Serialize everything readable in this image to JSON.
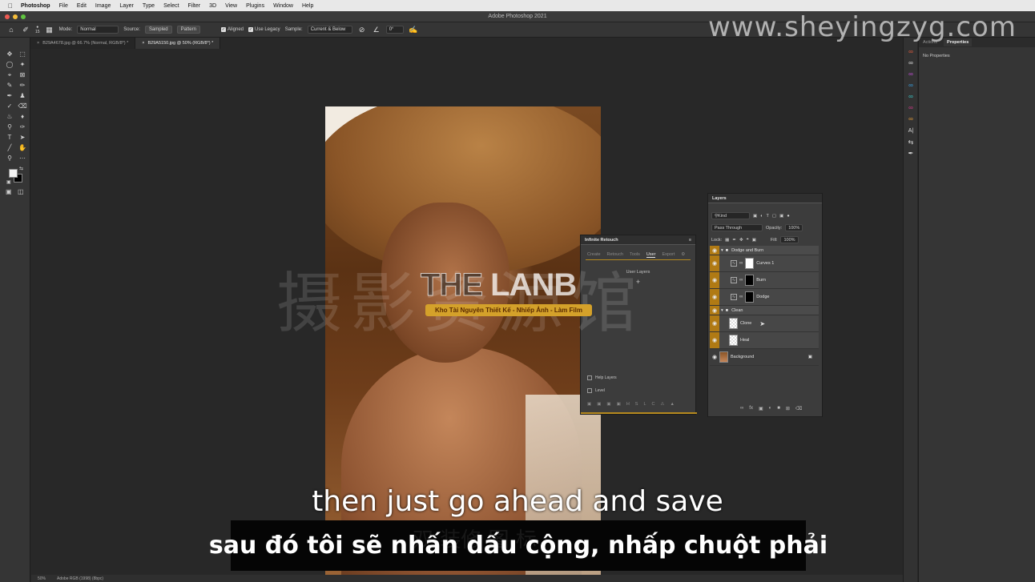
{
  "menubar": {
    "app": "Photoshop",
    "items": [
      "File",
      "Edit",
      "Image",
      "Layer",
      "Type",
      "Select",
      "Filter",
      "3D",
      "View",
      "Plugins",
      "Window",
      "Help"
    ]
  },
  "window": {
    "title": "Adobe Photoshop 2021"
  },
  "options": {
    "brush_size": "15",
    "mode_label": "Mode:",
    "mode_value": "Normal",
    "source_label": "Source:",
    "source_sampled": "Sampled",
    "source_pattern": "Pattern",
    "aligned": "Aligned",
    "use_legacy": "Use Legacy",
    "sample_label": "Sample:",
    "sample_value": "Current & Below",
    "angle": "0°"
  },
  "tabs": [
    {
      "label": "B29A4678.jpg @ 66.7% (Normal, RGB/8*) *"
    },
    {
      "label": "B29A5150.jpg @ 50% (RGB/8*) *"
    }
  ],
  "watermarks": {
    "site": "www.sheyingzyg.com",
    "chinese": "摄影资源馆",
    "lanb_left": "THE",
    "lanb_right": "LANB",
    "tagline": "Kho Tài Nguyên Thiết Kế - Nhiếp Ảnh - Làm Film",
    "ghost": "双 装修 图 标"
  },
  "subtitles": {
    "en": "then just go ahead and save",
    "vi": "sau đó tôi sẽ nhấn dấu cộng, nhấp chuột phải"
  },
  "retouch": {
    "title": "Infinite Retouch",
    "tabs": [
      "Create",
      "Retouch",
      "Tools",
      "User",
      "Export"
    ],
    "active_tab": "User",
    "user_layers": "User Layers",
    "plus": "+",
    "help_layers": "Help Layers",
    "level": "Level",
    "footer": [
      "H",
      "S",
      "L",
      "C"
    ]
  },
  "layers": {
    "title": "Layers",
    "kind": "Kind",
    "blend": "Pass Through",
    "opacity_label": "Opacity:",
    "opacity": "100%",
    "lock_label": "Lock:",
    "fill_label": "Fill:",
    "fill": "100%",
    "items": [
      {
        "name": "Dodge and Burn"
      },
      {
        "name": "Curves 1"
      },
      {
        "name": "Burn"
      },
      {
        "name": "Dodge"
      },
      {
        "name": "Clean"
      },
      {
        "name": "Clone"
      },
      {
        "name": "Heal"
      },
      {
        "name": "Background"
      }
    ]
  },
  "properties": {
    "tabs": [
      "Actions",
      "Properties"
    ],
    "message": "No Properties"
  },
  "status": {
    "zoom": "50%",
    "profile": "Adobe RGB (1998) (8bpc)"
  },
  "colors": {
    "layer_tag": "#b07a14",
    "retouch_accent": "#b68a1e",
    "tagline_bg": "#d4a12a"
  }
}
